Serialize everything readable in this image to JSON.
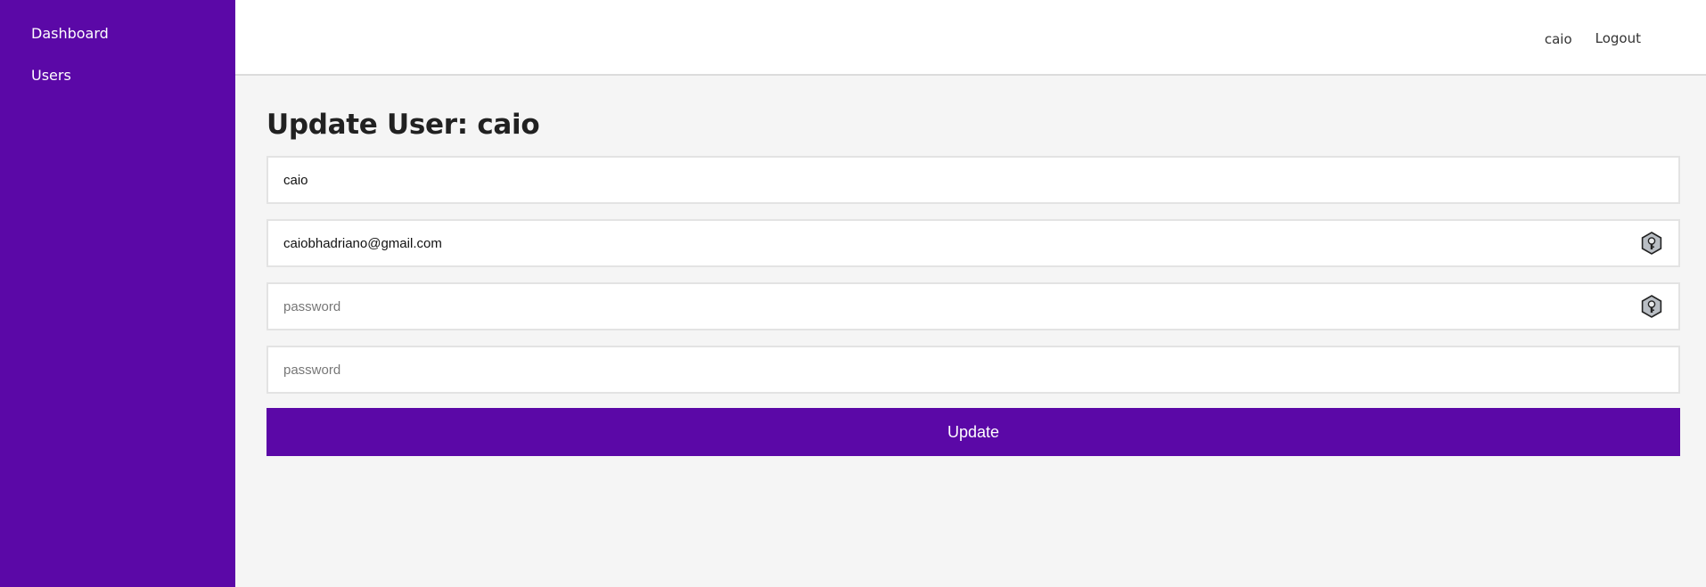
{
  "sidebar": {
    "items": [
      {
        "label": "Dashboard"
      },
      {
        "label": "Users"
      }
    ]
  },
  "topbar": {
    "username": "caio",
    "logout_label": "Logout"
  },
  "form": {
    "title": "Update User: caio",
    "name_value": "caio",
    "email_value": "caiobhadriano@gmail.com",
    "password_placeholder": "password",
    "password_confirm_placeholder": "password",
    "submit_label": "Update"
  },
  "icons": {
    "password_manager": "key-icon"
  },
  "colors": {
    "brand": "#5b08a7",
    "background": "#f5f5f5"
  }
}
